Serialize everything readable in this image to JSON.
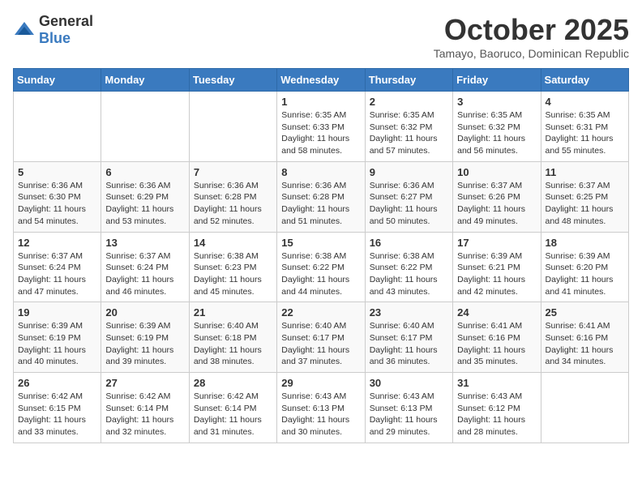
{
  "header": {
    "logo_general": "General",
    "logo_blue": "Blue",
    "month": "October 2025",
    "location": "Tamayo, Baoruco, Dominican Republic"
  },
  "weekdays": [
    "Sunday",
    "Monday",
    "Tuesday",
    "Wednesday",
    "Thursday",
    "Friday",
    "Saturday"
  ],
  "weeks": [
    [
      {
        "day": "",
        "text": ""
      },
      {
        "day": "",
        "text": ""
      },
      {
        "day": "",
        "text": ""
      },
      {
        "day": "1",
        "text": "Sunrise: 6:35 AM\nSunset: 6:33 PM\nDaylight: 11 hours and 58 minutes."
      },
      {
        "day": "2",
        "text": "Sunrise: 6:35 AM\nSunset: 6:32 PM\nDaylight: 11 hours and 57 minutes."
      },
      {
        "day": "3",
        "text": "Sunrise: 6:35 AM\nSunset: 6:32 PM\nDaylight: 11 hours and 56 minutes."
      },
      {
        "day": "4",
        "text": "Sunrise: 6:35 AM\nSunset: 6:31 PM\nDaylight: 11 hours and 55 minutes."
      }
    ],
    [
      {
        "day": "5",
        "text": "Sunrise: 6:36 AM\nSunset: 6:30 PM\nDaylight: 11 hours and 54 minutes."
      },
      {
        "day": "6",
        "text": "Sunrise: 6:36 AM\nSunset: 6:29 PM\nDaylight: 11 hours and 53 minutes."
      },
      {
        "day": "7",
        "text": "Sunrise: 6:36 AM\nSunset: 6:28 PM\nDaylight: 11 hours and 52 minutes."
      },
      {
        "day": "8",
        "text": "Sunrise: 6:36 AM\nSunset: 6:28 PM\nDaylight: 11 hours and 51 minutes."
      },
      {
        "day": "9",
        "text": "Sunrise: 6:36 AM\nSunset: 6:27 PM\nDaylight: 11 hours and 50 minutes."
      },
      {
        "day": "10",
        "text": "Sunrise: 6:37 AM\nSunset: 6:26 PM\nDaylight: 11 hours and 49 minutes."
      },
      {
        "day": "11",
        "text": "Sunrise: 6:37 AM\nSunset: 6:25 PM\nDaylight: 11 hours and 48 minutes."
      }
    ],
    [
      {
        "day": "12",
        "text": "Sunrise: 6:37 AM\nSunset: 6:24 PM\nDaylight: 11 hours and 47 minutes."
      },
      {
        "day": "13",
        "text": "Sunrise: 6:37 AM\nSunset: 6:24 PM\nDaylight: 11 hours and 46 minutes."
      },
      {
        "day": "14",
        "text": "Sunrise: 6:38 AM\nSunset: 6:23 PM\nDaylight: 11 hours and 45 minutes."
      },
      {
        "day": "15",
        "text": "Sunrise: 6:38 AM\nSunset: 6:22 PM\nDaylight: 11 hours and 44 minutes."
      },
      {
        "day": "16",
        "text": "Sunrise: 6:38 AM\nSunset: 6:22 PM\nDaylight: 11 hours and 43 minutes."
      },
      {
        "day": "17",
        "text": "Sunrise: 6:39 AM\nSunset: 6:21 PM\nDaylight: 11 hours and 42 minutes."
      },
      {
        "day": "18",
        "text": "Sunrise: 6:39 AM\nSunset: 6:20 PM\nDaylight: 11 hours and 41 minutes."
      }
    ],
    [
      {
        "day": "19",
        "text": "Sunrise: 6:39 AM\nSunset: 6:19 PM\nDaylight: 11 hours and 40 minutes."
      },
      {
        "day": "20",
        "text": "Sunrise: 6:39 AM\nSunset: 6:19 PM\nDaylight: 11 hours and 39 minutes."
      },
      {
        "day": "21",
        "text": "Sunrise: 6:40 AM\nSunset: 6:18 PM\nDaylight: 11 hours and 38 minutes."
      },
      {
        "day": "22",
        "text": "Sunrise: 6:40 AM\nSunset: 6:17 PM\nDaylight: 11 hours and 37 minutes."
      },
      {
        "day": "23",
        "text": "Sunrise: 6:40 AM\nSunset: 6:17 PM\nDaylight: 11 hours and 36 minutes."
      },
      {
        "day": "24",
        "text": "Sunrise: 6:41 AM\nSunset: 6:16 PM\nDaylight: 11 hours and 35 minutes."
      },
      {
        "day": "25",
        "text": "Sunrise: 6:41 AM\nSunset: 6:16 PM\nDaylight: 11 hours and 34 minutes."
      }
    ],
    [
      {
        "day": "26",
        "text": "Sunrise: 6:42 AM\nSunset: 6:15 PM\nDaylight: 11 hours and 33 minutes."
      },
      {
        "day": "27",
        "text": "Sunrise: 6:42 AM\nSunset: 6:14 PM\nDaylight: 11 hours and 32 minutes."
      },
      {
        "day": "28",
        "text": "Sunrise: 6:42 AM\nSunset: 6:14 PM\nDaylight: 11 hours and 31 minutes."
      },
      {
        "day": "29",
        "text": "Sunrise: 6:43 AM\nSunset: 6:13 PM\nDaylight: 11 hours and 30 minutes."
      },
      {
        "day": "30",
        "text": "Sunrise: 6:43 AM\nSunset: 6:13 PM\nDaylight: 11 hours and 29 minutes."
      },
      {
        "day": "31",
        "text": "Sunrise: 6:43 AM\nSunset: 6:12 PM\nDaylight: 11 hours and 28 minutes."
      },
      {
        "day": "",
        "text": ""
      }
    ]
  ]
}
